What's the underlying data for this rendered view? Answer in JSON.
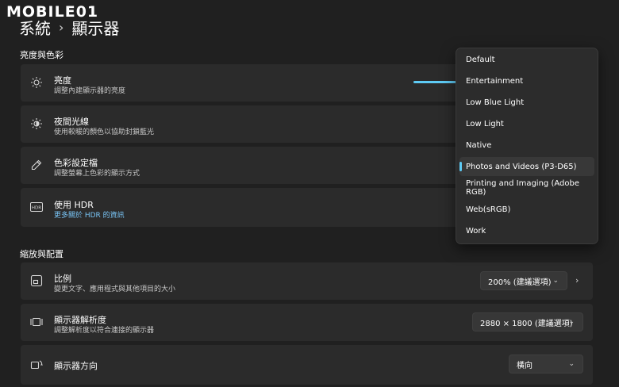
{
  "watermark": {
    "text": "MOBILE01"
  },
  "header": {
    "crumb": "系統",
    "separator": "›",
    "page": "顯示器"
  },
  "sections": {
    "brightness_color": "亮度與色彩",
    "scale_layout": "縮放與配置"
  },
  "rows": {
    "brightness": {
      "title": "亮度",
      "desc": "調整內建顯示器的亮度"
    },
    "night_light": {
      "title": "夜間光線",
      "desc": "使用較暖的顏色以協助封鎖藍光"
    },
    "color_profile": {
      "title": "色彩設定檔",
      "desc": "調整螢幕上色彩的顯示方式"
    },
    "hdr": {
      "title": "使用 HDR",
      "desc": "更多關於 HDR 的資訊"
    },
    "scale": {
      "title": "比例",
      "desc": "變更文字、應用程式與其他項目的大小",
      "value": "200% (建議選項)"
    },
    "resolution": {
      "title": "顯示器解析度",
      "desc": "調整解析度以符合連接的顯示器",
      "value": "2880 × 1800 (建議選項)"
    },
    "orientation": {
      "title": "顯示器方向",
      "value": "橫向"
    }
  },
  "color_profile_menu": {
    "items": [
      "Default",
      "Entertainment",
      "Low Blue Light",
      "Low Light",
      "Native",
      "Photos and Videos (P3-D65)",
      "Printing and Imaging (Adobe RGB)",
      "Web(sRGB)",
      "Work"
    ],
    "selected": "Photos and Videos (P3-D65)"
  },
  "colors": {
    "accent": "#5ecbf5",
    "link": "#79c4f5",
    "card": "#2b2b2b",
    "background": "#202020"
  },
  "icons": [
    "sun-icon",
    "night-light-icon",
    "eyedropper-icon",
    "hdr-icon",
    "scale-icon",
    "resolution-icon",
    "orientation-icon",
    "chevron-down-icon",
    "chevron-right-icon"
  ]
}
